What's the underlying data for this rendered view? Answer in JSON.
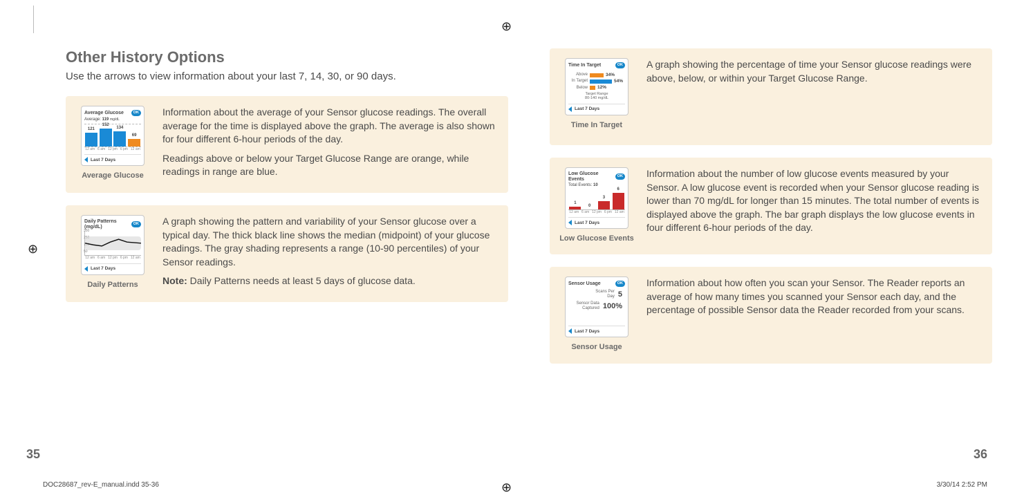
{
  "header": {
    "title": "Other History Options",
    "subtitle": "Use the arrows to view information about your last 7, 14, 30, or 90 days."
  },
  "common": {
    "ok_label": "OK",
    "footer_label": "Last 7 Days"
  },
  "avg_glucose": {
    "card_title": "Average Glucose",
    "avg_prefix": "Average:",
    "avg_value": "119",
    "avg_unit": "mg/dL",
    "caption": "Average Glucose",
    "desc1": "Information about the average of your Sensor glucose readings. The overall average for the time is displayed above the graph. The average is also shown for four different 6-hour periods of the day.",
    "desc2": "Readings above or below your Target Glucose Range are orange, while readings in range are blue."
  },
  "daily_patterns": {
    "card_title": "Daily Patterns (mg/dL)",
    "y_350": "350",
    "y_250": "250",
    "y_150": "150",
    "y_50": "50",
    "caption": "Daily Patterns",
    "desc1": "A graph showing the pattern and variability of your Sensor glucose over a typical day. The thick black line shows the median (midpoint) of your glucose readings. The gray shading represents a range (10-90 percentiles) of your Sensor readings.",
    "note_label": "Note:",
    "note_text": " Daily Patterns needs at least 5 days of glucose data."
  },
  "time_in_target": {
    "card_title": "Time In Target",
    "rows": {
      "above_label": "Above",
      "above_pct": "34%",
      "in_label": "In Target",
      "in_pct": "54%",
      "below_label": "Below",
      "below_pct": "12%"
    },
    "range_label": "Target Range",
    "range_value": "80-140 mg/dL",
    "caption": "Time In Target",
    "desc": "A graph showing the percentage of time your Sensor glucose readings were above, below, or within your Target Glucose Range."
  },
  "low_glucose": {
    "card_title": "Low Glucose Events",
    "total_label": "Total Events:",
    "total_value": "10",
    "caption": "Low Glucose Events",
    "desc": "Information about the number of low glucose events measured by your Sensor. A low glucose event is recorded when your Sensor glucose reading is lower than 70 mg/dL for longer than 15 minutes. The total number of events is displayed above the graph. The bar graph displays the low glucose events in four different 6-hour periods of the day."
  },
  "sensor_usage": {
    "card_title": "Sensor Usage",
    "row1_label": "Scans Per Day",
    "row1_value": "5",
    "row2_label": "Sensor Data Captured",
    "row2_value": "100%",
    "caption": "Sensor Usage",
    "desc": "Information about how often you scan your Sensor. The Reader reports an average of how many times you scanned your Sensor each day, and the percentage of possible Sensor data the Reader recorded from your scans."
  },
  "x_axis": {
    "ticks": [
      "12 am",
      "6 am",
      "12 pm",
      "6 pm",
      "12 am"
    ]
  },
  "chart_data": [
    {
      "id": "average_glucose",
      "type": "bar",
      "categories": [
        "12am-6am",
        "6am-12pm",
        "12pm-6pm",
        "6pm-12am"
      ],
      "values": [
        121,
        152,
        134,
        69
      ],
      "colors": [
        "blue",
        "blue",
        "blue",
        "orange"
      ],
      "overall_average": 119,
      "unit": "mg/dL"
    },
    {
      "id": "daily_patterns",
      "type": "line",
      "ylabel": "mg/dL",
      "ylim": [
        0,
        350
      ],
      "y_ticks": [
        50,
        150,
        250,
        350
      ],
      "x_ticks": [
        "12am",
        "6am",
        "12pm",
        "6pm",
        "12am"
      ],
      "series": [
        {
          "name": "p10",
          "values": [
            90,
            80,
            70,
            95,
            120,
            100,
            90
          ]
        },
        {
          "name": "median",
          "values": [
            120,
            105,
            100,
            135,
            155,
            130,
            120
          ]
        },
        {
          "name": "p90",
          "values": [
            160,
            150,
            140,
            190,
            210,
            175,
            160
          ]
        }
      ]
    },
    {
      "id": "time_in_target",
      "type": "bar",
      "orientation": "horizontal",
      "categories": [
        "Above",
        "In Target",
        "Below"
      ],
      "values": [
        34,
        54,
        12
      ],
      "colors": [
        "orange",
        "blue",
        "orange"
      ],
      "unit": "%",
      "target_range_mgdl": [
        80,
        140
      ]
    },
    {
      "id": "low_glucose_events",
      "type": "bar",
      "categories": [
        "12am-6am",
        "6am-12pm",
        "12pm-6pm",
        "6pm-12am"
      ],
      "values": [
        1,
        0,
        3,
        6
      ],
      "total": 10,
      "color": "red"
    },
    {
      "id": "sensor_usage",
      "type": "table",
      "rows": [
        {
          "label": "Scans Per Day",
          "value": 5
        },
        {
          "label": "Sensor Data Captured",
          "value": "100%"
        }
      ]
    }
  ],
  "pages": {
    "left_num": "35",
    "right_num": "36"
  },
  "footer": {
    "doc": "DOC28687_rev-E_manual.indd   35-36",
    "date": "3/30/14   2:52 PM"
  }
}
